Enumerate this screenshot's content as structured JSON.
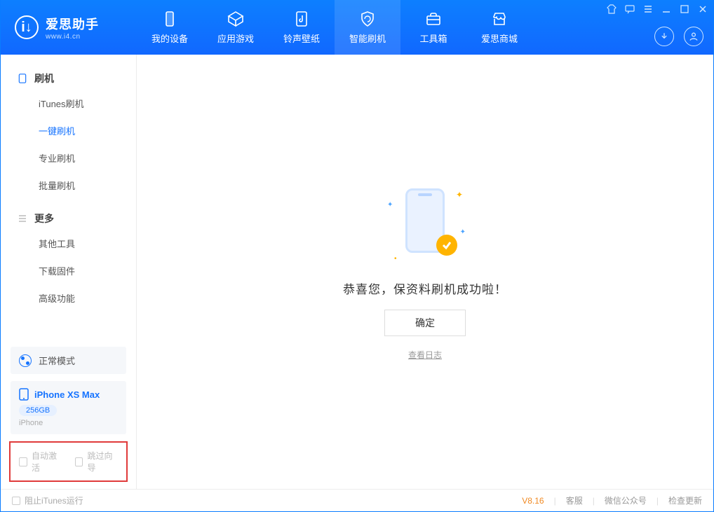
{
  "app": {
    "name_cn": "爱思助手",
    "url": "www.i4.cn"
  },
  "tabs": [
    {
      "key": "device",
      "label": "我的设备"
    },
    {
      "key": "apps",
      "label": "应用游戏"
    },
    {
      "key": "ring",
      "label": "铃声壁纸"
    },
    {
      "key": "flash",
      "label": "智能刷机"
    },
    {
      "key": "tools",
      "label": "工具箱"
    },
    {
      "key": "store",
      "label": "爱思商城"
    }
  ],
  "sidebar": {
    "flash": {
      "title": "刷机",
      "items": [
        {
          "key": "itunes",
          "label": "iTunes刷机"
        },
        {
          "key": "onekey",
          "label": "一键刷机"
        },
        {
          "key": "pro",
          "label": "专业刷机"
        },
        {
          "key": "batch",
          "label": "批量刷机"
        }
      ]
    },
    "more": {
      "title": "更多",
      "items": [
        {
          "key": "other",
          "label": "其他工具"
        },
        {
          "key": "fw",
          "label": "下载固件"
        },
        {
          "key": "adv",
          "label": "高级功能"
        }
      ]
    },
    "mode_label": "正常模式",
    "device": {
      "name": "iPhone XS Max",
      "capacity": "256GB",
      "type": "iPhone"
    },
    "options": {
      "auto_activate": "自动激活",
      "skip_guide": "跳过向导"
    }
  },
  "main": {
    "success_msg": "恭喜您，保资料刷机成功啦！",
    "ok_label": "确定",
    "log_link": "查看日志"
  },
  "footer": {
    "block_itunes": "阻止iTunes运行",
    "version": "V8.16",
    "links": {
      "service": "客服",
      "wechat": "微信公众号",
      "update": "检查更新"
    }
  }
}
